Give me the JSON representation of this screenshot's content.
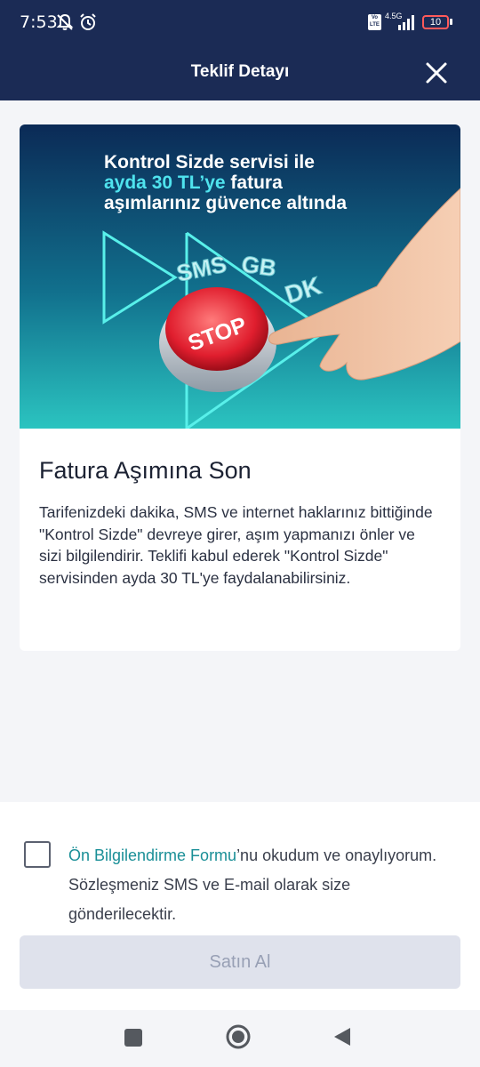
{
  "status": {
    "time": "7:53",
    "battery": "10",
    "network": "4.5G",
    "volte": "Vo LTE"
  },
  "header": {
    "title": "Teklif Detayı"
  },
  "banner": {
    "line1": "Kontrol Sizde servisi ile",
    "line2_highlight": "ayda 30 TL’ye",
    "line2_rest": " fatura",
    "line3": "aşımlarınız güvence altında",
    "tag_sms": "SMS",
    "tag_gb": "GB",
    "tag_dk": "DK",
    "button_text": "STOP"
  },
  "card": {
    "title": "Fatura Aşımına Son",
    "description": "Tarifenizdeki dakika, SMS ve internet haklarınız bittiğinde \"Kontrol Sizde\" devreye girer, aşım yapmanızı önler ve sizi bilgilendirir. Teklifi kabul ederek \"Kontrol Sizde\" servisinden ayda 30 TL'ye faydalanabilirsiniz."
  },
  "consent": {
    "link": "Ön Bilgilendirme Formu",
    "text": "’nu okudum ve onaylıyorum. Sözleşmeniz SMS ve E-mail olarak size gönderilecektir.",
    "checked": false
  },
  "buy_button": {
    "label": "Satın Al"
  },
  "colors": {
    "header_bg": "#1b2b55",
    "link": "#1a8f97",
    "button_disabled_bg": "#dfe2ec",
    "button_disabled_text": "#98a0b5"
  }
}
